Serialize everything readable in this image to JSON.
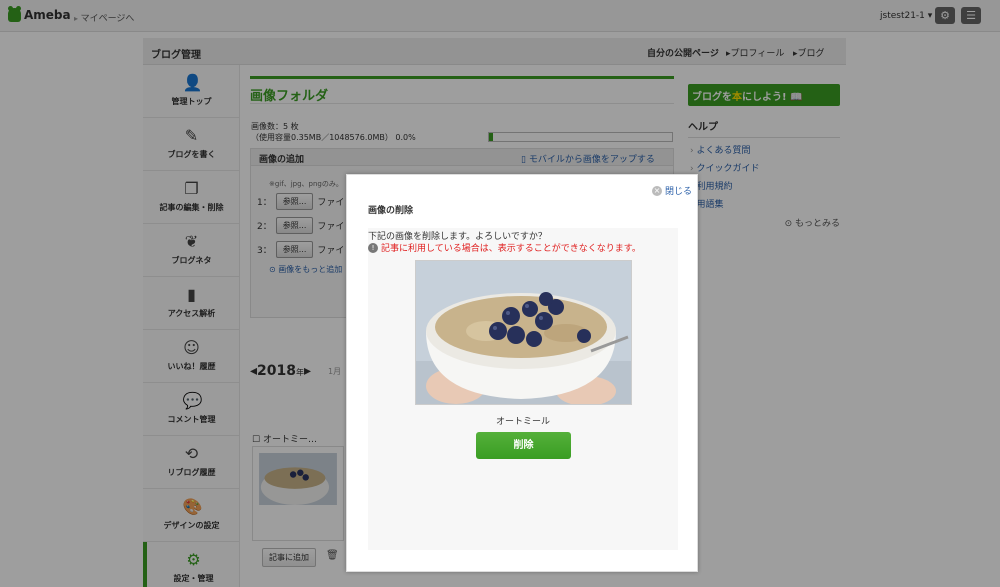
{
  "topbar": {
    "logo": "Ameba",
    "mypage_link": "マイページへ",
    "username": "jstest21-1 ▾",
    "settings_icon": "gear-icon",
    "menu_icon": "hamburger-icon"
  },
  "panel": {
    "title": "ブログ管理",
    "nav": {
      "public_page": "自分の公開ページ",
      "profile": "▸プロフィール",
      "blog": "▸ブログ"
    }
  },
  "sidebar": {
    "items": [
      {
        "label": "管理トップ",
        "icon": "person-icon"
      },
      {
        "label": "ブログを書く",
        "icon": "pencil-icon"
      },
      {
        "label": "記事の編集・削除",
        "icon": "documents-icon"
      },
      {
        "label": "ブログネタ",
        "icon": "sprout-icon"
      },
      {
        "label": "アクセス解析",
        "icon": "bar-chart-icon"
      },
      {
        "label": "いいね！履歴",
        "icon": "smile-icon"
      },
      {
        "label": "コメント管理",
        "icon": "speech-bubbles-icon"
      },
      {
        "label": "リブログ履歴",
        "icon": "reblog-icon"
      },
      {
        "label": "デザインの設定",
        "icon": "palette-icon"
      },
      {
        "label": "設定・管理",
        "icon": "gear-icon"
      }
    ]
  },
  "main": {
    "title": "画像フォルダ",
    "count": "画像数：5 枚",
    "usage": "（使用容量0.35MB／1048576.0MB） 0.0%",
    "usage_fraction": 0.02,
    "add_title": "画像の追加",
    "mobile_link": "モバイルから画像をアップする",
    "formats": "※gif、jpg、pngのみ。",
    "rows": [
      {
        "num": "1：",
        "button": "参照...",
        "text": "ファイ"
      },
      {
        "num": "2：",
        "button": "参照...",
        "text": "ファイ"
      },
      {
        "num": "3：",
        "button": "参照...",
        "text": "ファイ"
      }
    ],
    "more_images": "画像をもっと追加",
    "year": "2018",
    "year_suffix": "年",
    "month": "1月",
    "oatmeal_label": "オートミー…",
    "article_button": "記事に追加"
  },
  "right": {
    "banner_pre": "ブログを",
    "banner_mid": "本",
    "banner_post": "にしよう!",
    "help_title": "ヘルプ",
    "help_items": [
      "よくある質問",
      "クイックガイド",
      "利用規約",
      "用語集"
    ],
    "more": "もっとみる"
  },
  "modal": {
    "close": "閉じる",
    "title": "画像の削除",
    "confirm": "下記の画像を削除します。よろしいですか？",
    "warning": "記事に利用している場合は、表示することができなくなります。",
    "caption": "オートミール",
    "delete_button": "削除"
  }
}
